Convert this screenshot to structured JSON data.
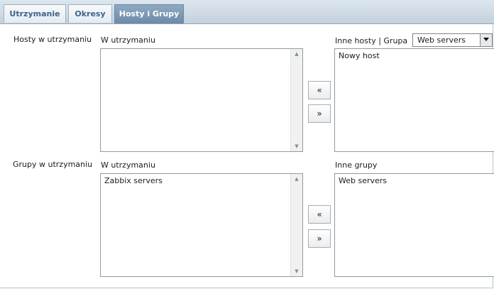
{
  "tabs": [
    {
      "label": "Utrzymanie",
      "active": false
    },
    {
      "label": "Okresy",
      "active": false
    },
    {
      "label": "Hosty i Grupy",
      "active": true
    }
  ],
  "hosts_section": {
    "row_label": "Hosty w utrzymaniu",
    "left_header": "W utrzymaniu",
    "left_items": [],
    "right_header": "Inne hosty | Grupa",
    "group_select": {
      "value": "Web servers"
    },
    "right_items": [
      "Nowy host"
    ],
    "add_button": "«",
    "remove_button": "»"
  },
  "groups_section": {
    "row_label": "Grupy w utrzymaniu",
    "left_header": "W utrzymaniu",
    "left_items": [
      "Zabbix servers"
    ],
    "right_header": "Inne grupy",
    "right_items": [
      "Web servers"
    ],
    "add_button": "«",
    "remove_button": "»"
  }
}
